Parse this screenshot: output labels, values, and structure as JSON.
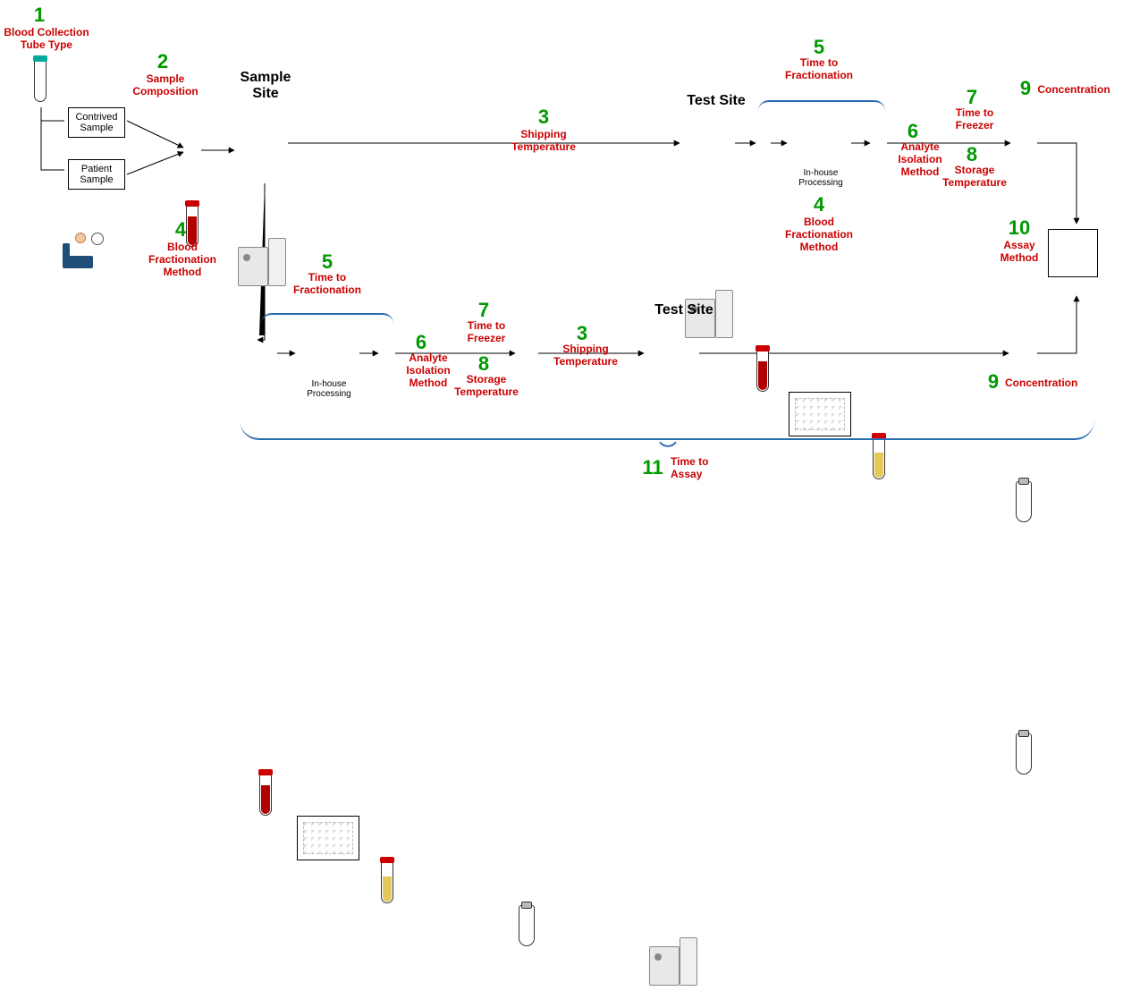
{
  "steps": {
    "s1": {
      "num": "1",
      "label": "Blood Collection\nTube Type"
    },
    "s2": {
      "num": "2",
      "label": "Sample\nComposition"
    },
    "s3a": {
      "num": "3",
      "label": "Shipping\nTemperature"
    },
    "s3b": {
      "num": "3",
      "label": "Shipping\nTemperature"
    },
    "s4_left": {
      "num": "4",
      "label": "Blood\nFractionation\nMethod"
    },
    "s4_top": {
      "num": "4",
      "label": "Blood\nFractionation\nMethod"
    },
    "s5_top": {
      "num": "5",
      "label": "Time to\nFractionation"
    },
    "s5_bot": {
      "num": "5",
      "label": "Time to\nFractionation"
    },
    "s6_top": {
      "num": "6",
      "label": "Analyte\nIsolation\nMethod"
    },
    "s6_bot": {
      "num": "6",
      "label": "Analyte\nIsolation\nMethod"
    },
    "s7_top": {
      "num": "7",
      "label": "Time to\nFreezer"
    },
    "s7_bot": {
      "num": "7",
      "label": "Time to\nFreezer"
    },
    "s8_top": {
      "num": "8",
      "label": "Storage\nTemperature"
    },
    "s8_bot": {
      "num": "8",
      "label": "Storage\nTemperature"
    },
    "s9_top": {
      "num": "9",
      "label": "Concentration"
    },
    "s9_bot": {
      "num": "9",
      "label": "Concentration"
    },
    "s10": {
      "num": "10",
      "label": "Assay\nMethod"
    },
    "s11": {
      "num": "11",
      "label": "Time to\nAssay"
    }
  },
  "titles": {
    "sample_site": "Sample\nSite",
    "test_site_top": "Test Site",
    "test_site_bot": "Test Site"
  },
  "boxes": {
    "contrived": "Contrived\nSample",
    "patient": "Patient\nSample",
    "inhouse_top": "In-house\nProcessing",
    "inhouse_bot": "In-house\nProcessing"
  }
}
